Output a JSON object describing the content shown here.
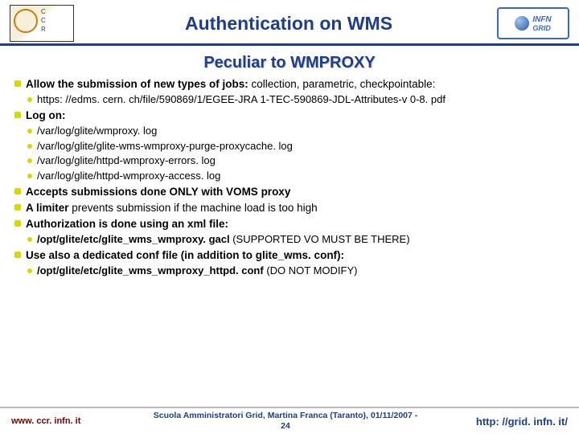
{
  "header": {
    "title": "Authentication on WMS",
    "logo_left_alt": "CCR logo",
    "logo_right_text_a": "INFN",
    "logo_right_text_b": "GRID"
  },
  "subtitle": "Peculiar to WMPROXY",
  "bullets": {
    "submission": {
      "lead": "Allow the submission of new types of jobs: ",
      "types": "collection, parametric, checkpointable:",
      "link": "https: //edms. cern. ch/file/590869/1/EGEE-JRA 1-TEC-590869-JDL-Attributes-v 0-8. pdf"
    },
    "logon": {
      "label": "Log on:",
      "items": [
        "/var/log/glite/wmproxy. log",
        "/var/log/glite/glite-wms-wmproxy-purge-proxycache. log",
        "/var/log/glite/httpd-wmproxy-errors. log",
        "/var/log/glite/httpd-wmproxy-access. log"
      ]
    },
    "voms": "Accepts submissions done ONLY with VOMS proxy",
    "limiter_a": "A limiter ",
    "limiter_b": "prevents submission if the machine load is too high",
    "auth": "Authorization is done using an xml file:",
    "gacl_path": "/opt/glite/etc/glite_wms_wmproxy. gacl ",
    "gacl_note": "(SUPPORTED VO MUST BE THERE)",
    "conf": "Use also a dedicated conf file (in addition to glite_wms. conf):",
    "conf_path": "/opt/glite/etc/glite_wms_wmproxy_httpd. conf ",
    "conf_note": "(DO NOT MODIFY)"
  },
  "footer": {
    "left": "www. ccr. infn. it",
    "mid_line1": "Scuola Amministratori Grid, Martina Franca (Taranto), 01/11/2007 -",
    "mid_line2": "24",
    "right": "http: //grid. infn. it/"
  }
}
